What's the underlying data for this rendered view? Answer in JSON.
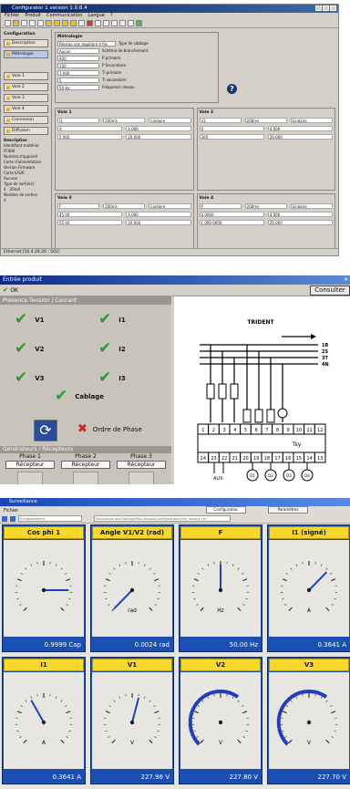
{
  "s1": {
    "title": "Configurator 1 version 1.0.8.4",
    "menu": [
      "Fichier",
      "Produit",
      "Communication",
      "Langue",
      "?"
    ],
    "left": {
      "group_title": "Configuration",
      "buttons": [
        "Description",
        "Métrologie",
        "",
        "Voie 1",
        "Voie 2",
        "Voie 3",
        "Voie 4"
      ],
      "actions": [
        "Connexion",
        "Diffusion"
      ],
      "info_labels": [
        "Description",
        "Identifiant matériel",
        "FF006",
        "Numéro d'appareil",
        "",
        "Carte d'alimentation",
        "",
        "Version Firmware",
        "",
        "Carte E/S/R",
        "Aucune",
        "Type de sortie(s)",
        "4 - 20mA",
        "Nombre de sorties",
        "4"
      ]
    },
    "metro": {
      "title": "Métrologie",
      "rows": [
        {
          "value": "Réseau non équilibré 4 fils",
          "label": "Type de câblage"
        },
        {
          "value": "Aucun",
          "label": "Schéma de branchement"
        },
        {
          "value": "400",
          "label": "P primaire"
        },
        {
          "value": "100",
          "label": "P Secondaire"
        },
        {
          "value": "1 000",
          "label": "Ti primaire"
        },
        {
          "value": "5",
          "label": "Ti secondaire"
        },
        {
          "value": "50 Hz",
          "label": "Fréquence réseau"
        }
      ],
      "help_label": "?"
    },
    "voies": [
      {
        "title": "Voie 1",
        "grandeur": "I1",
        "temps": "200ms",
        "fonction": "Linéaire",
        "mes_min": "0",
        "mes_max": "5 000",
        "sortie_min": "4.000",
        "sortie_max": "20.000"
      },
      {
        "title": "Voie 2",
        "grandeur": "V1",
        "temps": "200ms",
        "fonction": "Linéaire",
        "mes_min": "0",
        "mes_max": "300",
        "sortie_min": "4.000",
        "sortie_max": "20.000"
      },
      {
        "title": "Voie 3",
        "grandeur": "F",
        "temps": "200ms",
        "fonction": "Linéaire",
        "mes_min": "45.00",
        "mes_max": "55.00",
        "sortie_min": "4.000",
        "sortie_max": "20.000"
      },
      {
        "title": "Voie 4",
        "grandeur": "P",
        "temps": "200ms",
        "fonction": "Linéaire",
        "mes_min": "0.0000",
        "mes_max": "1 000.0000",
        "sortie_min": "4.000",
        "sortie_max": "20.000"
      }
    ],
    "status": "Ethernet [10.4.28.20 : 502]"
  },
  "s2": {
    "title": "Entrée produit",
    "ok_label": "OK",
    "consult_label": "Consulter",
    "presence_title": "Présence Tension / Courant",
    "checks": [
      "V1",
      "V2",
      "V3",
      "I1",
      "I2",
      "I3"
    ],
    "cablage": "Cablage",
    "ordre": "Ordre de Phase",
    "gen_title": "Générateurs / Récepteurs",
    "phases": [
      {
        "name": "Phase 1",
        "state": "Récepteur"
      },
      {
        "name": "Phase 2",
        "state": "Récepteur"
      },
      {
        "name": "Phase 3",
        "state": "Récepteur"
      }
    ],
    "diagram": {
      "title": "TRIDENT",
      "lines": [
        "1R",
        "2S",
        "3T",
        "4N"
      ],
      "terminals_top": [
        "1",
        "2",
        "3",
        "4",
        "5",
        "6",
        "7",
        "8",
        "9",
        "10",
        "11",
        "12"
      ],
      "device": "Tsy",
      "terminals_bottom": [
        "24",
        "23",
        "22",
        "21",
        "20",
        "19",
        "18",
        "17",
        "16",
        "15",
        "14",
        "13"
      ],
      "aux": "AUX.",
      "outputs": [
        "O1",
        "O2",
        "O3",
        "O4"
      ]
    }
  },
  "s3": {
    "title": "Surveillance",
    "menu": "Fichier",
    "tabs": [
      "Configuration",
      "Paramètres"
    ],
    "combo1": "Enregistrement",
    "combo2": "Documents and Settings\\Mon Bureau\\Configurations\\test_mesure.csv",
    "gauges": [
      {
        "title": "Cos phi 1",
        "value": "0.9999 Cap",
        "unit": ""
      },
      {
        "title": "Angle V1/V2 (rad)",
        "value": "0.0024 rad",
        "unit": "rad"
      },
      {
        "title": "F",
        "value": "50.00 Hz",
        "unit": "Hz"
      },
      {
        "title": "I1 (signé)",
        "value": "0.3641 A",
        "unit": "A"
      },
      {
        "title": "I1",
        "value": "0.3641 A",
        "unit": "A"
      },
      {
        "title": "V1",
        "value": "227.96 V",
        "unit": "V"
      },
      {
        "title": "V2",
        "value": "227.80 V",
        "unit": "V"
      },
      {
        "title": "V3",
        "value": "227.70 V",
        "unit": "V"
      }
    ],
    "colors": {
      "panel": "#1c4fb4",
      "title": "#f8d828",
      "needle": "#1f3fbf"
    }
  }
}
